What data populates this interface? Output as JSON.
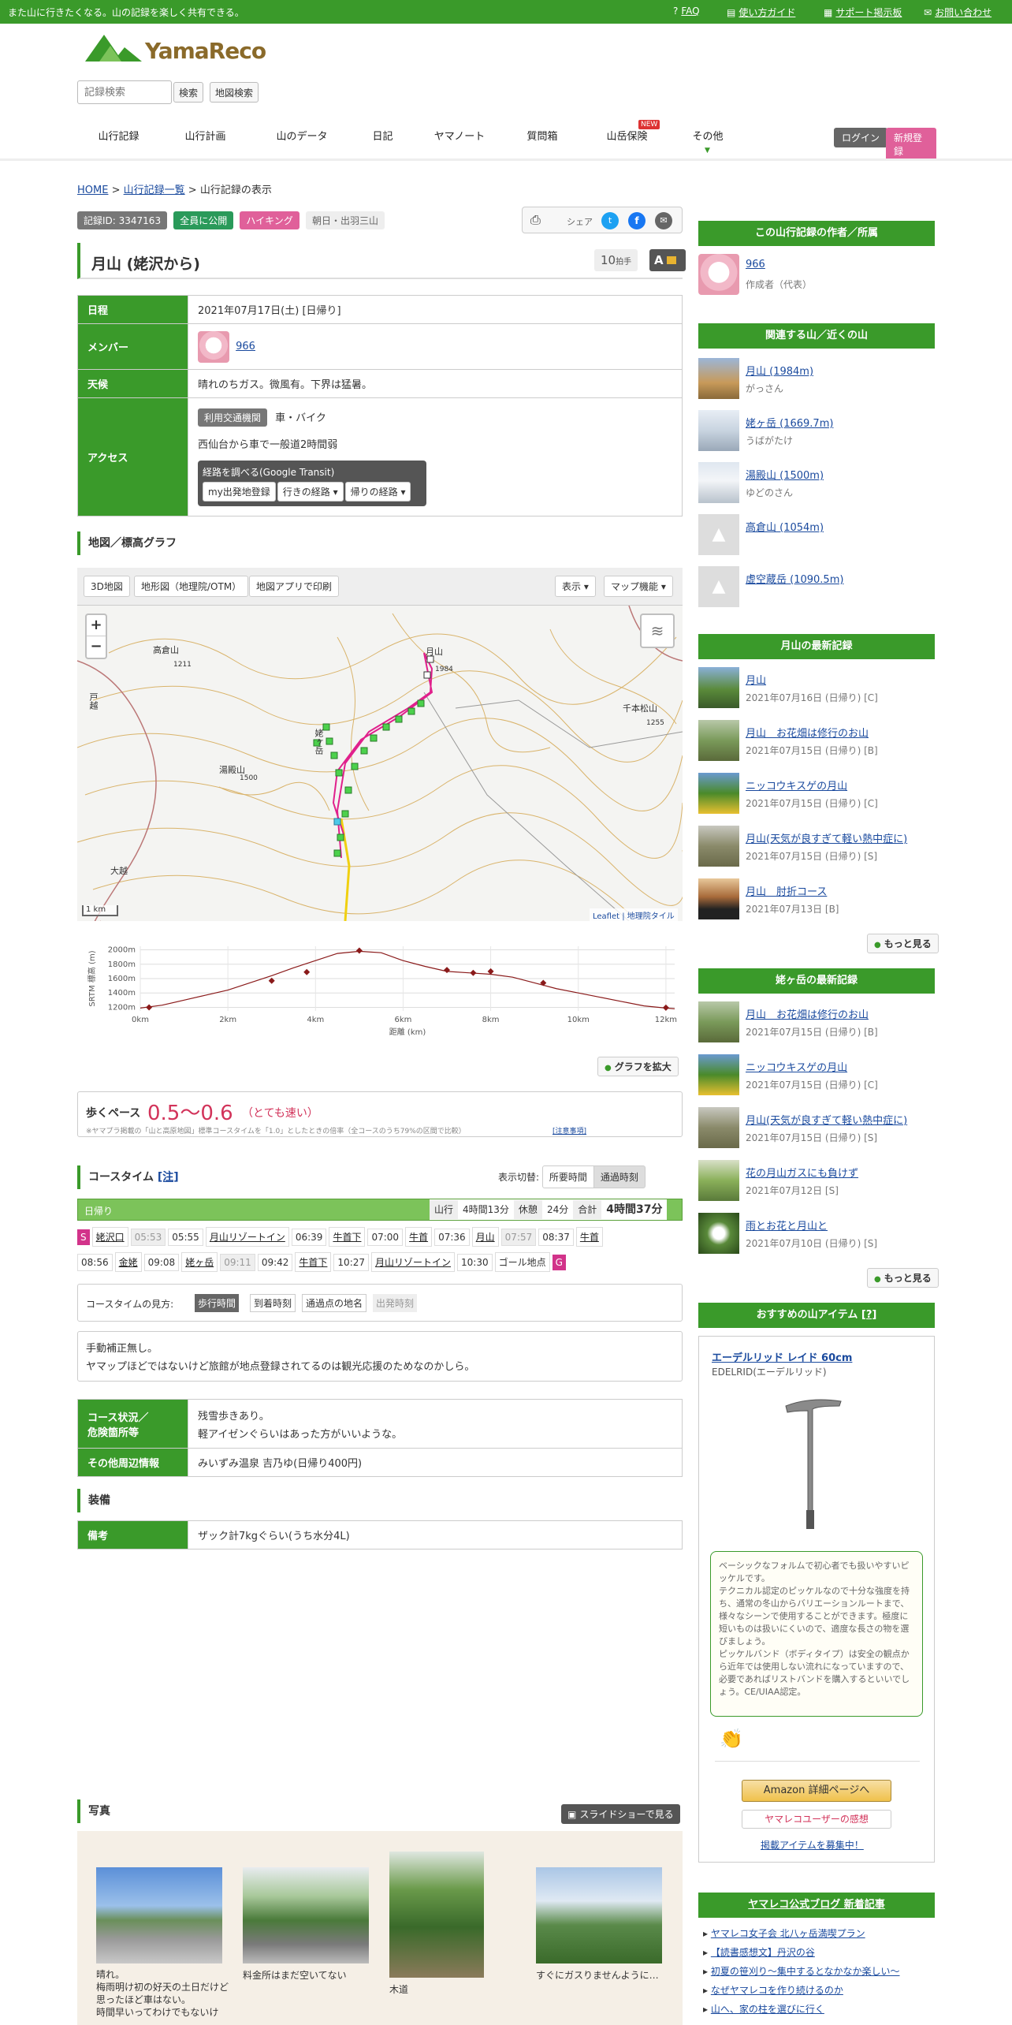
{
  "topbar": {
    "message": "また山に行きたくなる。山の記録を楽しく共有できる。",
    "links": [
      "FAQ",
      "使い方ガイド",
      "サポート掲示板",
      "お問い合わせ"
    ]
  },
  "header": {
    "logo_text": "YamaReco",
    "search_placeholder": "記録検索",
    "search_button": "検索",
    "map_search_button": "地図検索",
    "nav": [
      "山行記録",
      "山行計画",
      "山のデータ",
      "日記",
      "ヤマノート",
      "質問箱",
      "山岳保険",
      "その他"
    ],
    "nav_new_badge": "NEW",
    "login": "ログイン",
    "signup": "新規登録"
  },
  "breadcrumb": {
    "home": "HOME",
    "list": "山行記録一覧",
    "current": "山行記録の表示"
  },
  "record": {
    "tags": [
      "記録ID: 3347163",
      "全員に公開",
      "ハイキング",
      "朝日・出羽三山"
    ],
    "share_label": "シェア",
    "title": "月山 (姥沢から)",
    "claps": "10",
    "claps_unit": "拍手",
    "grade": "A",
    "rows": {
      "date_label": "日程",
      "date": "2021年07月17日(土) [日帰り]",
      "member_label": "メンバー",
      "member": "966",
      "weather_label": "天候",
      "weather": "晴れのちガス。微風有。下界は猛暑。",
      "access_label": "アクセス",
      "access_transport_tag": "利用交通機関",
      "access_transport": "車・バイク",
      "access_note": "西仙台から車で一般道2時間弱",
      "transit_title": "経路を調べる(Google Transit)",
      "transit_buttons": [
        "my出発地登録",
        "行きの経路 ▾",
        "帰りの経路 ▾"
      ]
    }
  },
  "map_section": {
    "heading": "地図／標高グラフ",
    "tools": [
      "3D地図",
      "地形図（地理院/OTM）",
      "地図アプリで印刷"
    ],
    "right_tools": [
      "表示 ▾",
      "マップ機能 ▾"
    ],
    "zoom_in": "+",
    "zoom_out": "−",
    "scale": "1 km",
    "attribution": "Leaflet | 地理院タイル",
    "labels": [
      "月山",
      "1984",
      "湯殿山",
      "1500",
      "姥ヶ岳",
      "千本松山",
      "1255",
      "高倉山",
      "1211",
      "大越",
      "戸越"
    ]
  },
  "chart_data": {
    "type": "line",
    "ylabel": "SRTM 標高 (m)",
    "xlabel": "距離 (km)",
    "x_ticks": [
      "0km",
      "2km",
      "4km",
      "6km",
      "8km",
      "10km",
      "12km"
    ],
    "y_ticks": [
      "2000m",
      "1800m",
      "1600m",
      "1400m",
      "1200m"
    ],
    "xlim": [
      0,
      12.2
    ],
    "ylim": [
      1150,
      2050
    ],
    "x": [
      0,
      0.5,
      1,
      1.5,
      2,
      2.5,
      3,
      3.5,
      4,
      4.5,
      5,
      5.5,
      6,
      6.5,
      7,
      7.5,
      8,
      8.5,
      9,
      9.5,
      10,
      10.5,
      11,
      11.5,
      12,
      12.2
    ],
    "y": [
      1190,
      1230,
      1300,
      1370,
      1440,
      1540,
      1640,
      1750,
      1850,
      1950,
      1980,
      1960,
      1850,
      1770,
      1700,
      1680,
      1660,
      1620,
      1540,
      1460,
      1400,
      1340,
      1280,
      1220,
      1190,
      1180
    ],
    "markers_x": [
      0.2,
      3.0,
      3.8,
      5.0,
      7.0,
      7.6,
      8.0,
      9.2,
      12.0
    ],
    "markers_y": [
      1200,
      1570,
      1690,
      1990,
      1720,
      1680,
      1700,
      1540,
      1195
    ]
  },
  "graph_expand": "グラフを拡大",
  "pace": {
    "label": "歩くペース",
    "value": "0.5～0.6",
    "desc": "（とても速い）",
    "note": "※ヤマプラ掲載の「山と高原地図」標準コースタイムを「1.0」としたときの倍率（全コースのうち79%の区間で比較）",
    "note_link": "[注意事項]"
  },
  "coursetime": {
    "heading": "コースタイム",
    "note_link": "[注]",
    "toggle_label": "表示切替:",
    "toggle": [
      "所要時間",
      "通過時刻"
    ],
    "day": "日帰り",
    "stats": [
      "山行",
      "4時間13分",
      "休憩",
      "24分",
      "合計",
      "4時間37分"
    ],
    "line1": [
      {
        "t": "S",
        "k": "start"
      },
      {
        "t": "姥沢口",
        "k": "place"
      },
      {
        "t": "05:53",
        "k": "dep"
      },
      {
        "t": "05:55",
        "k": "time"
      },
      {
        "t": "月山リゾートイン",
        "k": "place"
      },
      {
        "t": "06:39",
        "k": "time"
      },
      {
        "t": "牛首下",
        "k": "place"
      },
      {
        "t": "07:00",
        "k": "time"
      },
      {
        "t": "牛首",
        "k": "place"
      },
      {
        "t": "07:36",
        "k": "time"
      },
      {
        "t": "月山",
        "k": "place"
      },
      {
        "t": "07:57",
        "k": "dep"
      },
      {
        "t": "08:37",
        "k": "time"
      },
      {
        "t": "牛首",
        "k": "place"
      }
    ],
    "line2": [
      {
        "t": "08:56",
        "k": "time"
      },
      {
        "t": "金姥",
        "k": "place"
      },
      {
        "t": "09:08",
        "k": "time"
      },
      {
        "t": "姥ヶ岳",
        "k": "place"
      },
      {
        "t": "09:11",
        "k": "dep"
      },
      {
        "t": "09:42",
        "k": "time"
      },
      {
        "t": "牛首下",
        "k": "place"
      },
      {
        "t": "10:27",
        "k": "time"
      },
      {
        "t": "月山リゾートイン",
        "k": "place"
      },
      {
        "t": "10:30",
        "k": "time"
      },
      {
        "t": "ゴール地点",
        "k": "plain"
      },
      {
        "t": "G",
        "k": "goal"
      }
    ],
    "legend_label": "コースタイムの見方:",
    "legend": [
      "歩行時間",
      "到着時刻",
      "通過点の地名",
      "出発時刻"
    ]
  },
  "comment": {
    "line1": "手動補正無し。",
    "line2": "ヤマップほどではないけど旅館が地点登録されてるのは観光応援のためなのかしら。"
  },
  "course_info": {
    "status_label_1": "コース状況／",
    "status_label_2": "危険箇所等",
    "status_1": "残雪歩きあり。",
    "status_2": "軽アイゼンぐらいはあった方がいいような。",
    "other_label": "その他周辺情報",
    "other": "みいずみ温泉 吉乃ゆ(日帰り400円)"
  },
  "equipment": {
    "heading": "装備",
    "label": "備考",
    "value": "ザック計7kgぐらい(うち水分4L)"
  },
  "photos": {
    "heading": "写真",
    "slideshow": "スライドショーで見る",
    "captions": [
      "晴れ。\n梅雨明け初の好天の土日だけど思ったほど車はない。\n時間早いってわけでもないけ",
      "料金所はまだ空いてない",
      "木道",
      "すぐにガスりませんように…"
    ]
  },
  "sidebar": {
    "author_head": "この山行記録の作者／所属",
    "author_name": "966",
    "author_role": "作成者（代表）",
    "related_head": "関連する山／近くの山",
    "related": [
      {
        "name": "月山 (1984m)",
        "kana": "がっさん"
      },
      {
        "name": "姥ヶ岳 (1669.7m)",
        "kana": "うばがたけ"
      },
      {
        "name": "湯殿山 (1500m)",
        "kana": "ゆどのさん"
      },
      {
        "name": "高倉山 (1054m)",
        "kana": ""
      },
      {
        "name": "虚空蔵岳 (1090.5m)",
        "kana": ""
      }
    ],
    "gassan_head": "月山の最新記録",
    "gassan": [
      {
        "title": "月山",
        "date": "2021年07月16日 (日帰り) [C]"
      },
      {
        "title": "月山　お花畑は修行のお山",
        "date": "2021年07月15日 (日帰り) [B]"
      },
      {
        "title": "ニッコウキスゲの月山",
        "date": "2021年07月15日 (日帰り) [C]"
      },
      {
        "title": "月山(天気が良すぎて軽い熱中症に)",
        "date": "2021年07月15日 (日帰り) [S]"
      },
      {
        "title": "月山　肘折コース",
        "date": "2021年07月13日 [B]"
      }
    ],
    "more": "もっと見る",
    "uba_head": "姥ヶ岳の最新記録",
    "uba": [
      {
        "title": "月山　お花畑は修行のお山",
        "date": "2021年07月15日 (日帰り) [B]"
      },
      {
        "title": "ニッコウキスゲの月山",
        "date": "2021年07月15日 (日帰り) [C]"
      },
      {
        "title": "月山(天気が良すぎて軽い熱中症に)",
        "date": "2021年07月15日 (日帰り) [S]"
      },
      {
        "title": "花の月山ガスにも負けず",
        "date": "2021年07月12日 [S]"
      },
      {
        "title": "雨とお花と月山と",
        "date": "2021年07月10日 (日帰り) [S]"
      }
    ],
    "item_head": "おすすめの山アイテム",
    "item_head_link": "[?]",
    "item_name": "エーデルリッド レイド 60cm",
    "item_brand": "EDELRID(エーデルリッド)",
    "item_desc": "ベーシックなフォルムで初心者でも扱いやすいピッケルです。\nテクニカル認定のピッケルなので十分な強度を持ち、通常の冬山からバリエーションルートまで、様々なシーンで使用することができます。極度に短いものは扱いにくいので、適度な長さの物を選びましょう。\nピッケルバンド（ボディタイプ）は安全の観点から近年では使用しない流れになっていますので、必要であればリストバンドを購入するといいでしょう。CE/UIAA認定。",
    "amazon_btn": "Amazon 詳細ページへ",
    "review_btn": "ヤマレコユーザーの感想",
    "recruit_link": "掲載アイテムを募集中！",
    "blog_head": "ヤマレコ公式ブログ 新着記事",
    "blog": [
      "ヤマレコ女子会 北八ヶ岳満喫プラン",
      "【読書感想文】丹沢の谷",
      "初夏の笹刈り～集中するとなかなか楽しい～",
      "なぜヤマレコを作り続けるのか",
      "山へ、家の柱を選びに行く"
    ]
  }
}
